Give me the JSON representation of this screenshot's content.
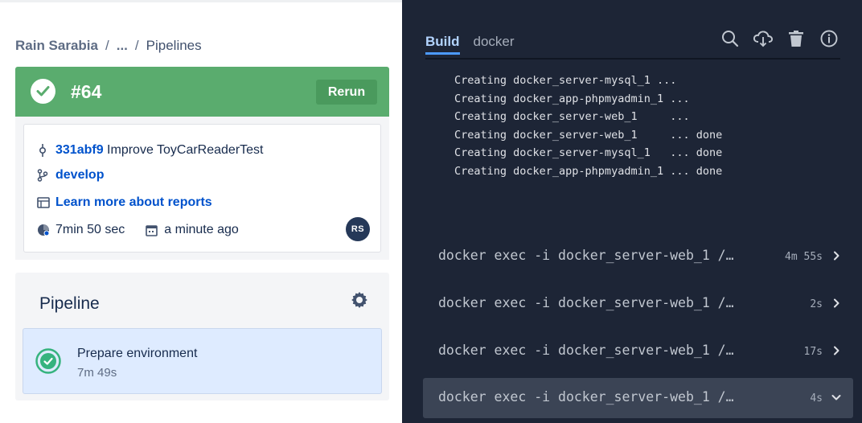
{
  "breadcrumb": {
    "owner": "Rain Sarabia",
    "ellipsis": "...",
    "current": "Pipelines"
  },
  "build": {
    "number": "#64",
    "rerun_label": "Rerun",
    "status_color": "#5aac6e"
  },
  "details": {
    "commit_hash": "331abf9",
    "commit_message": "Improve ToyCarReaderTest",
    "branch": "develop",
    "reports_link": "Learn more about reports",
    "duration": "7min 50 sec",
    "time_ago": "a minute ago",
    "avatar_initials": "RS"
  },
  "pipeline": {
    "title": "Pipeline",
    "steps": [
      {
        "name": "Prepare environment",
        "duration": "7m 49s"
      }
    ]
  },
  "console": {
    "tabs": [
      {
        "label": "Build",
        "active": true
      },
      {
        "label": "docker",
        "active": false
      }
    ],
    "tools": [
      "search-icon",
      "download-icon",
      "trash-icon",
      "info-icon"
    ],
    "log_lines": [
      "Creating docker_server-mysql_1 ...",
      "Creating docker_app-phpmyadmin_1 ...",
      "Creating docker_server-web_1     ...",
      "Creating docker_server-web_1     ... done",
      "Creating docker_server-mysql_1   ... done",
      "Creating docker_app-phpmyadmin_1 ... done"
    ],
    "commands": [
      {
        "text": "docker exec -i docker_server-web_1 /…",
        "duration": "4m 55s",
        "expanded": false
      },
      {
        "text": "docker exec -i docker_server-web_1 /…",
        "duration": "2s",
        "expanded": false
      },
      {
        "text": "docker exec -i docker_server-web_1 /…",
        "duration": "17s",
        "expanded": false
      },
      {
        "text": "docker exec -i docker_server-web_1 /…",
        "duration": "4s",
        "expanded": true
      }
    ]
  }
}
